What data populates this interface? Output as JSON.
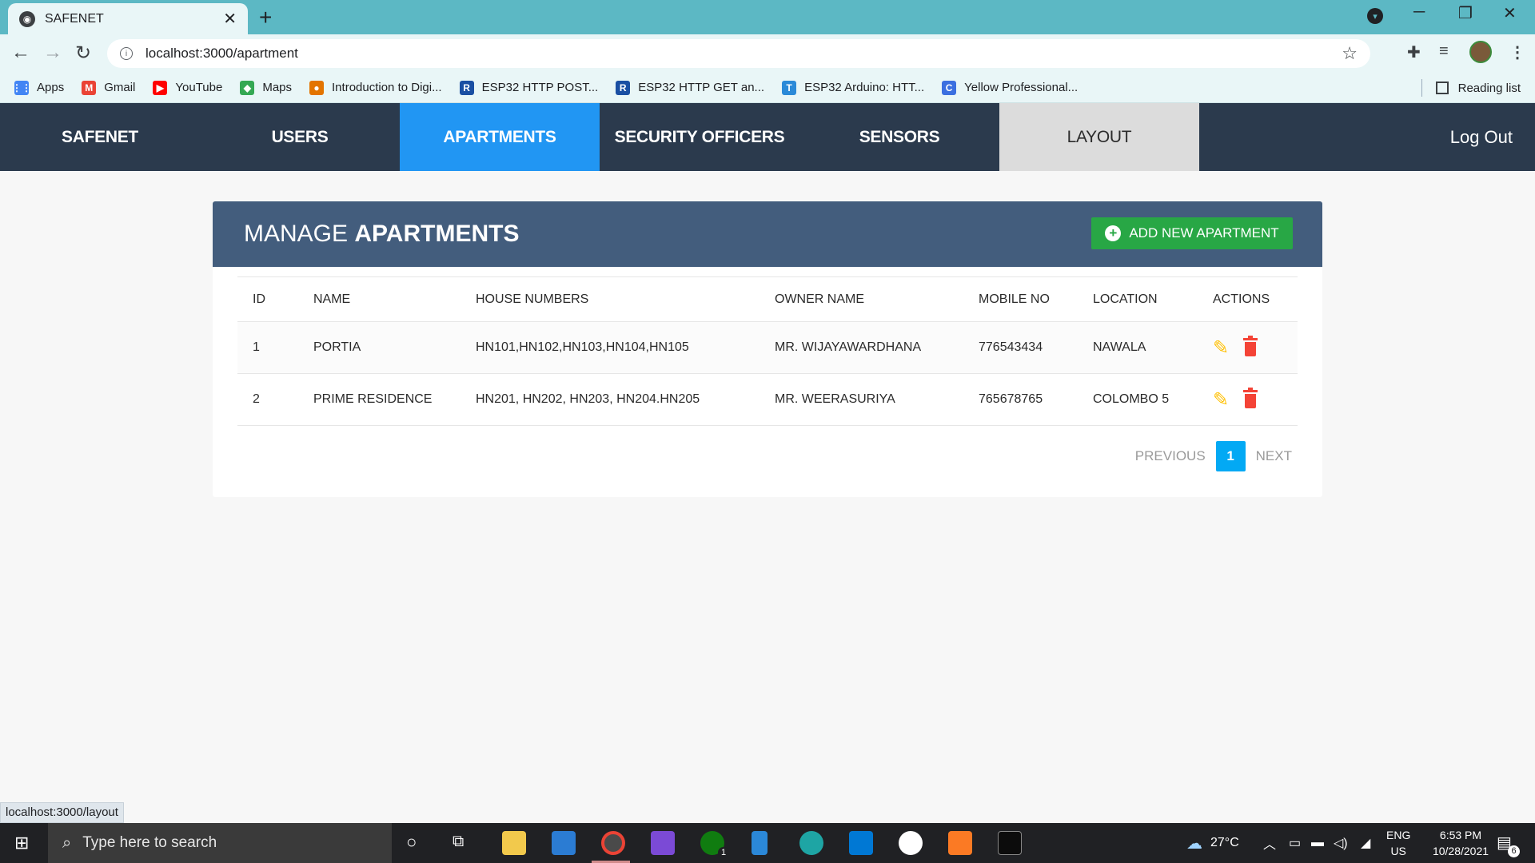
{
  "browser": {
    "tab_title": "SAFENET",
    "tab_close": "✕",
    "new_tab": "+",
    "url": "localhost:3000/apartment",
    "bookmarks": [
      {
        "label": "Apps",
        "color": "#4285f4",
        "icon": "apps-grid-icon"
      },
      {
        "label": "Gmail",
        "color": "#ea4335",
        "icon": "gmail-icon"
      },
      {
        "label": "YouTube",
        "color": "#ff0000",
        "icon": "youtube-icon"
      },
      {
        "label": "Maps",
        "color": "#34a853",
        "icon": "maps-icon"
      },
      {
        "label": "Introduction to Digi...",
        "color": "#e37400",
        "icon": "site-icon"
      },
      {
        "label": "ESP32 HTTP POST...",
        "color": "#1a4fa3",
        "icon": "r-icon"
      },
      {
        "label": "ESP32 HTTP GET an...",
        "color": "#1a4fa3",
        "icon": "r-icon"
      },
      {
        "label": "ESP32 Arduino: HTT...",
        "color": "#2b8ad8",
        "icon": "tk-icon"
      },
      {
        "label": "Yellow Professional...",
        "color": "#3b6fe0",
        "icon": "c-icon"
      }
    ],
    "reading_list": "Reading list",
    "status_url": "localhost:3000/layout"
  },
  "nav": {
    "items": [
      {
        "label": "SAFENET"
      },
      {
        "label": "USERS"
      },
      {
        "label": "APARTMENTS"
      },
      {
        "label": "SECURITY OFFICERS"
      },
      {
        "label": "SENSORS"
      },
      {
        "label": "LAYOUT"
      }
    ],
    "logout": "Log Out"
  },
  "page": {
    "title_light": "MANAGE ",
    "title_bold": "APARTMENTS",
    "add_button": "ADD NEW APARTMENT"
  },
  "table": {
    "columns": [
      "ID",
      "NAME",
      "HOUSE NUMBERS",
      "OWNER NAME",
      "MOBILE NO",
      "LOCATION",
      "ACTIONS"
    ],
    "rows": [
      {
        "id": "1",
        "name": "PORTIA",
        "houses": "HN101,HN102,HN103,HN104,HN105",
        "owner": "MR. WIJAYAWARDHANA",
        "mobile": "776543434",
        "location": "NAWALA"
      },
      {
        "id": "2",
        "name": "PRIME RESIDENCE",
        "houses": "HN201, HN202, HN203, HN204.HN205",
        "owner": "MR. WEERASURIYA",
        "mobile": "765678765",
        "location": "COLOMBO 5"
      }
    ]
  },
  "pagination": {
    "previous": "PREVIOUS",
    "current": "1",
    "next": "NEXT"
  },
  "taskbar": {
    "search_placeholder": "Type here to search",
    "weather": "27°C",
    "lang_top": "ENG",
    "lang_bottom": "US",
    "time": "6:53 PM",
    "date": "10/28/2021",
    "xbox_badge": "1",
    "notif_count": "6"
  },
  "colors": {
    "nav_bg": "#2b3a4d",
    "active_tab": "#2196f3",
    "header_bg": "#435d7d",
    "add_btn": "#28a745",
    "edit": "#ffc107",
    "delete": "#f44336",
    "page_active": "#03a9f4"
  }
}
